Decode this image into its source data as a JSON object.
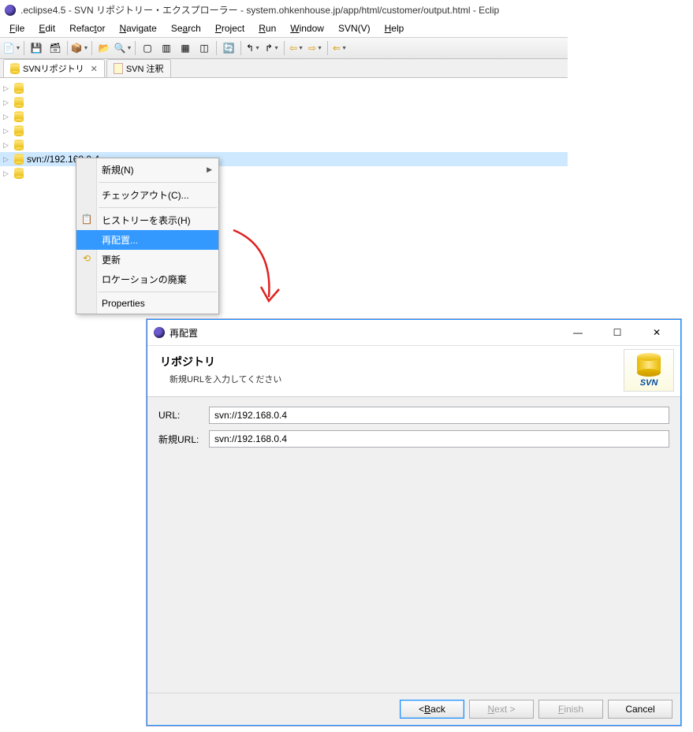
{
  "window": {
    "title": ".eclipse4.5 - SVN リポジトリー・エクスプローラー - system.ohkenhouse.jp/app/html/customer/output.html - Eclip"
  },
  "menu": {
    "file": "File",
    "edit": "Edit",
    "refactor": "Refactor",
    "navigate": "Navigate",
    "search": "Search",
    "project": "Project",
    "run": "Run",
    "window": "Window",
    "svn": "SVN(V)",
    "help": "Help"
  },
  "tabs": {
    "repo": "SVNリポジトリ",
    "annotate": "SVN 注釈"
  },
  "tree": {
    "selected_label": "svn://192.168.0.4"
  },
  "context": {
    "new": "新規(N)",
    "checkout": "チェックアウト(C)...",
    "history": "ヒストリーを表示(H)",
    "relocate": "再配置...",
    "refresh": "更新",
    "discard": "ロケーションの廃棄",
    "properties": "Properties"
  },
  "dialog": {
    "title": "再配置",
    "heading": "リポジトリ",
    "subtext": "新規URLを入力してください",
    "url_label": "URL:",
    "url_value": "svn://192.168.0.4",
    "newurl_label": "新規URL:",
    "newurl_value": "svn://192.168.0.4",
    "svn_badge": "SVN",
    "back": "Back",
    "next": "Next >",
    "finish": "Finish",
    "cancel": "Cancel"
  }
}
